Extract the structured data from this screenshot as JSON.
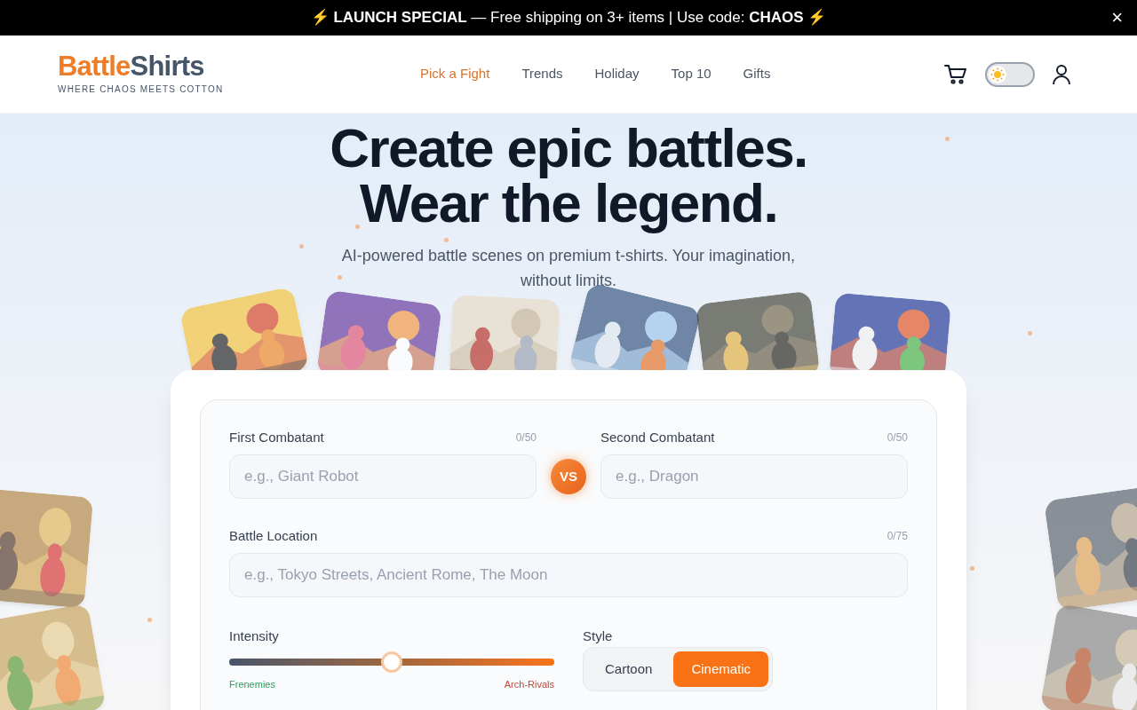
{
  "banner": {
    "text": "⚡ **LAUNCH SPECIAL** — Free shipping on 3+ items | Use code: **CHAOS** ⚡",
    "close": "×"
  },
  "logo": {
    "first": "Battle",
    "second": "Shirts",
    "tagline": "WHERE CHAOS MEETS COTTON"
  },
  "nav": [
    {
      "label": "Pick a Fight",
      "selected": true
    },
    {
      "label": "Trends",
      "selected": false
    },
    {
      "label": "Holiday",
      "selected": false
    },
    {
      "label": "Top 10",
      "selected": false
    },
    {
      "label": "Gifts",
      "selected": false
    }
  ],
  "theme_toggle": {
    "dark": false
  },
  "hero": {
    "title_lines": [
      "Create epic battles.",
      "Wear the legend."
    ],
    "subtitle": "AI-powered battle scenes on premium t-shirts. Your imagination, without limits."
  },
  "form": {
    "first": {
      "label": "First Combatant",
      "counter": "0/50",
      "placeholder": "e.g., Giant Robot"
    },
    "vs": "VS",
    "second": {
      "label": "Second Combatant",
      "counter": "0/50",
      "placeholder": "e.g., Dragon"
    },
    "location": {
      "label": "Battle Location",
      "counter": "0/75",
      "placeholder": "e.g., Tokyo Streets, Ancient Rome, The Moon"
    },
    "intensity": {
      "label": "Intensity",
      "level": 0.5,
      "min_label": "Frenemies",
      "max_label": "Arch-Rivals"
    },
    "style": {
      "label": "Style",
      "options": [
        {
          "label": "Cartoon",
          "selected": false
        },
        {
          "label": "Cinematic",
          "selected": true
        }
      ]
    }
  }
}
